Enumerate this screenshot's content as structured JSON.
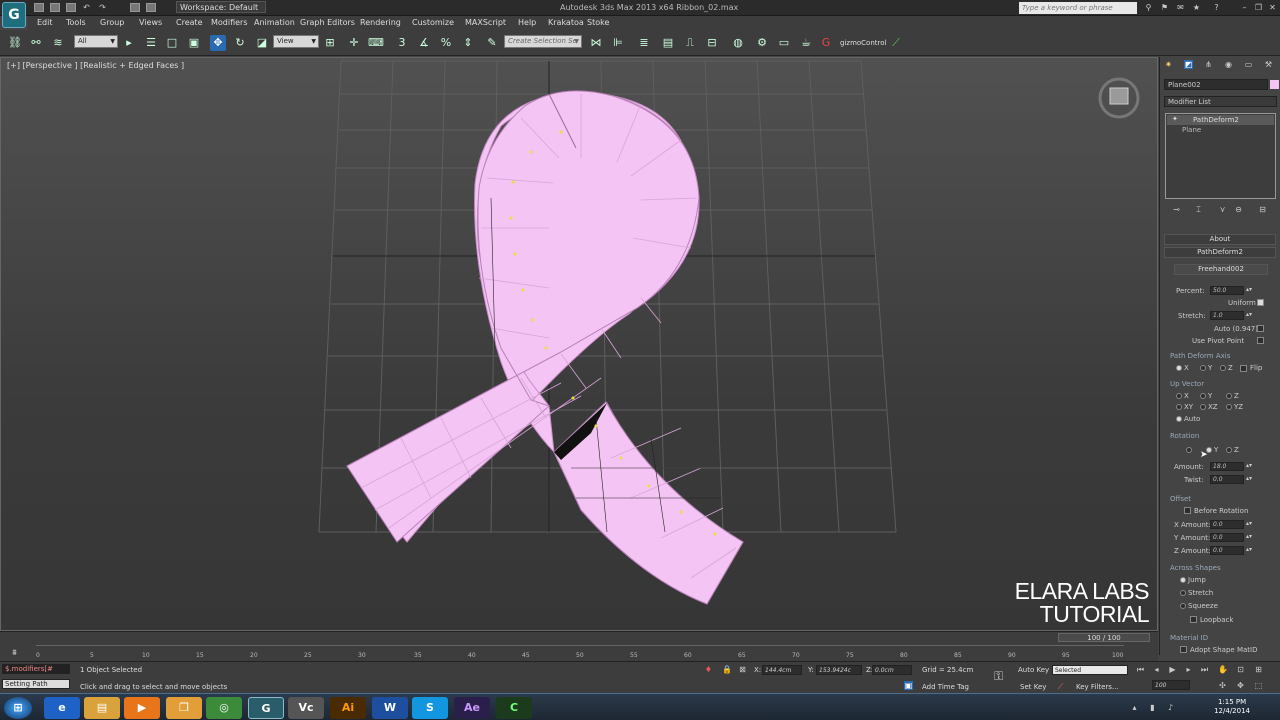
{
  "window": {
    "title": "Autodesk 3ds Max  2013 x64     Ribbon_02.max",
    "workspace": "Workspace: Default",
    "search_placeholder": "Type a keyword or phrase"
  },
  "menu": [
    "Edit",
    "Tools",
    "Group",
    "Views",
    "Create",
    "Modifiers",
    "Animation",
    "Graph Editors",
    "Rendering",
    "Customize",
    "MAXScript",
    "Help",
    "Krakatoa",
    "Stoke"
  ],
  "toolbar": {
    "filter_value": "All",
    "refcoord_value": "View",
    "selection_set_placeholder": "Create Selection Se",
    "gizmo_label": "gizmoControl"
  },
  "viewport": {
    "label": "[+] [Perspective ] [Realistic + Edged Faces ]",
    "watermark_line1": "ELARA LABS",
    "watermark_line2": "TUTORIAL"
  },
  "command_panel": {
    "object_name": "Plane002",
    "modifier_list": "Modifier List",
    "stack": [
      "PathDeform2",
      "Plane"
    ],
    "rollout_about": "About",
    "rollout_pathdeform": "PathDeform2",
    "path_button": "Freehand002",
    "percent_label": "Percent:",
    "percent_value": "50.0",
    "uniform_label": "Uniform",
    "stretch_label": "Stretch:",
    "stretch_value": "1.0",
    "auto_label": "Auto (0.947)",
    "pivot_label": "Use Pivot Point",
    "axis_group": "Path Deform Axis",
    "axis_x": "X",
    "axis_y": "Y",
    "axis_z": "Z",
    "axis_flip": "Flip",
    "up_group": "Up Vector",
    "up_x": "X",
    "up_y": "Y",
    "up_z": "Z",
    "up_xy": "XY",
    "up_xz": "XZ",
    "up_yz": "YZ",
    "up_auto": "Auto",
    "rotation_group": "Rotation",
    "rot_y": "Y",
    "rot_z": "Z",
    "amount_label": "Amount:",
    "amount_value": "18.0",
    "twist_label": "Twist:",
    "twist_value": "0.0",
    "offset_group": "Offset",
    "before_rotation": "Before Rotation",
    "x_amount_label": "X Amount:",
    "x_amount_value": "0.0",
    "y_amount_label": "Y Amount:",
    "y_amount_value": "0.0",
    "z_amount_label": "Z Amount:",
    "z_amount_value": "0.0",
    "across_group": "Across Shapes",
    "opt_jump": "Jump",
    "opt_stretch": "Stretch",
    "opt_squeeze": "Squeeze",
    "loopback": "Loopback",
    "material_group": "Material ID",
    "adopt_matid": "Adopt Shape MatID"
  },
  "timeline": {
    "slider": "100 / 100",
    "ticks": [
      "0",
      "5",
      "10",
      "15",
      "20",
      "25",
      "30",
      "35",
      "40",
      "45",
      "50",
      "55",
      "60",
      "65",
      "70",
      "75",
      "80",
      "85",
      "90",
      "95",
      "100"
    ]
  },
  "status": {
    "maxscript_line1": "$.modifiers[#",
    "maxscript_line2": "Setting Path",
    "selected": "1 Object Selected",
    "prompt": "Click and drag to select and move objects",
    "x_label": "X:",
    "x_value": "144.4cm",
    "y_label": "Y:",
    "y_value": "153.9424c",
    "z_label": "Z:",
    "z_value": "0.0cm",
    "grid": "Grid = 25.4cm",
    "add_time_tag": "Add Time Tag",
    "auto_key": "Auto Key",
    "set_key": "Set Key",
    "key_mode": "Selected",
    "key_filters": "Key Filters...",
    "frame": "100"
  },
  "taskbar": {
    "time": "1:15 PM",
    "date": "12/4/2014",
    "apps": [
      "Vc",
      "Ai",
      "W",
      "S",
      "Ae",
      "C"
    ]
  },
  "colors": {
    "ribbon": "#f4c4f4",
    "active_tool": "#2a6ab0"
  }
}
